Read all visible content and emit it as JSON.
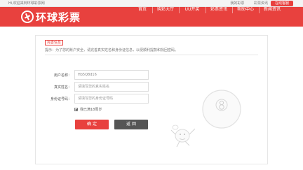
{
  "topbar": {
    "welcome": "Hi,欢迎来到环球彩票网",
    "links": [
      "我的彩票",
      "彩票资讯"
    ],
    "service_label": "在线客服"
  },
  "header": {
    "logo_text": "环球彩票",
    "nav": [
      "首页",
      "购彩大厅",
      "UU开奖",
      "彩票资讯",
      "帮助中心",
      "新闻资讯"
    ]
  },
  "form": {
    "badge": "完善信息",
    "tip": "提示：为了您的账户安全，请完善真实姓名和身份证信息，以便顺利提款和找回密码。",
    "fields": [
      {
        "label": "用户名称：",
        "value": "Hb5Q8d16",
        "placeholder": ""
      },
      {
        "label": "真实姓名：",
        "value": "",
        "placeholder": "请填写您的真实姓名"
      },
      {
        "label": "身份证号码：",
        "value": "",
        "placeholder": "请填写您的身份证号码"
      }
    ],
    "agree_label": "我已满18周岁",
    "confirm_label": "确 定",
    "back_label": "返 回"
  }
}
